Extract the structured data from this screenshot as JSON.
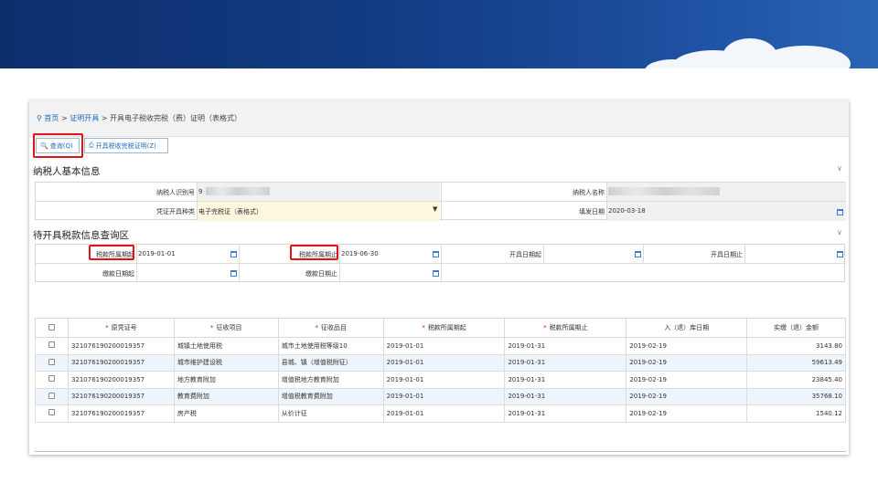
{
  "breadcrumb": {
    "home": "首页",
    "sep1": ">",
    "level1": "证明开具",
    "sep2": ">",
    "current": "开具电子税收完税（费）证明（表格式）"
  },
  "toolbar": {
    "query_label": "查询(Q)",
    "issue_label": "开具税收完税证明(Z)"
  },
  "taxpayer_section": {
    "title": "纳税人基本信息",
    "id_label": "纳税人识别号",
    "id_value": "9",
    "name_label": "纳税人名称",
    "voucher_type_label": "凭证开具种类",
    "voucher_type_value": "电子完税证（表格式）",
    "fill_date_label": "填发日期",
    "fill_date_value": "2020-03-18"
  },
  "query_section": {
    "title": "待开具税款信息查询区",
    "period_start_label": "税款所属期起",
    "period_start_value": "2019-01-01",
    "period_end_label": "税款所属期止",
    "period_end_value": "2019-06-30",
    "issue_start_label": "开具日期起",
    "issue_end_label": "开具日期止",
    "pay_start_label": "缴款日期起",
    "pay_end_label": "缴款日期止"
  },
  "table": {
    "required_mark": "*",
    "headers": [
      "原凭证号",
      "征收项目",
      "征收品目",
      "税款所属期起",
      "税款所属期止",
      "入（退）库日期",
      "实缴（退）金额"
    ],
    "rows": [
      [
        "321076190200019357",
        "城镇土地使用税",
        "城市土地使用税等级10",
        "2019-01-01",
        "2019-01-31",
        "2019-02-19",
        "3143.80"
      ],
      [
        "321076190200019357",
        "城市维护建设税",
        "县城、镇（增值税附征）",
        "2019-01-01",
        "2019-01-31",
        "2019-02-19",
        "59613.49"
      ],
      [
        "321076190200019357",
        "地方教育附加",
        "增值税地方教育附加",
        "2019-01-01",
        "2019-01-31",
        "2019-02-19",
        "23845.40"
      ],
      [
        "321076190200019357",
        "教育费附加",
        "增值税教育费附加",
        "2019-01-01",
        "2019-01-31",
        "2019-02-19",
        "35768.10"
      ],
      [
        "321076190200019357",
        "房产税",
        "从价计征",
        "2019-01-01",
        "2019-01-31",
        "2019-02-19",
        "1540.12"
      ]
    ]
  },
  "colors": {
    "accent": "#1e6bbf",
    "highlight_box": "#e0141b",
    "banner": "#123a80"
  }
}
